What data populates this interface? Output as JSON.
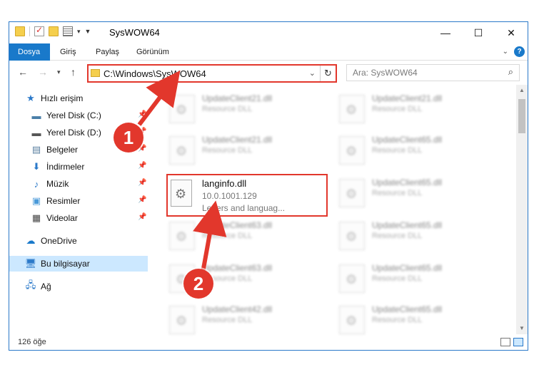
{
  "window": {
    "title": "SysWOW64",
    "controls": {
      "minimize": "—",
      "maximize": "☐",
      "close": "✕"
    }
  },
  "ribbon": {
    "tabs": [
      "Dosya",
      "Giriş",
      "Paylaş",
      "Görünüm"
    ],
    "accent_color": "#1979ca"
  },
  "nav": {
    "address": "C:\\Windows\\SysWOW64",
    "search_placeholder": "Ara: SysWOW64"
  },
  "sidebar": {
    "items": [
      {
        "label": "Hızlı erişim",
        "icon": "star-icon"
      },
      {
        "label": "Yerel Disk (C:)",
        "icon": "drive-icon",
        "pinned": true
      },
      {
        "label": "Yerel Disk (D:)",
        "icon": "drive-icon",
        "pinned": true
      },
      {
        "label": "Belgeler",
        "icon": "documents-icon",
        "pinned": true
      },
      {
        "label": "İndirmeler",
        "icon": "download-icon",
        "pinned": true
      },
      {
        "label": "Müzik",
        "icon": "music-icon",
        "pinned": true
      },
      {
        "label": "Resimler",
        "icon": "pictures-icon",
        "pinned": true
      },
      {
        "label": "Videolar",
        "icon": "videos-icon",
        "pinned": true
      },
      {
        "label": "OneDrive",
        "icon": "cloud-icon"
      },
      {
        "label": "Bu bilgisayar",
        "icon": "computer-icon",
        "selected": true
      },
      {
        "label": "Ağ",
        "icon": "network-icon"
      }
    ]
  },
  "files": {
    "blurred": [
      {
        "name": "UpdateClient21.dll",
        "desc": "Resource DLL"
      },
      {
        "name": "UpdateClient21.dll",
        "desc": "Resource DLL"
      },
      {
        "name": "UpdateClient21.dll",
        "desc": "Resource DLL"
      },
      {
        "name": "UpdateClient65.dll",
        "desc": "Resource DLL"
      },
      {
        "name": "UpdateClient65.dll",
        "desc": "Resource DLL"
      },
      {
        "name": "UpdateClient63.dll",
        "desc": "Resource DLL"
      },
      {
        "name": "UpdateClient65.dll",
        "desc": "Resource DLL"
      },
      {
        "name": "UpdateClient63.dll",
        "desc": "Resource DLL"
      },
      {
        "name": "UpdateClient65.dll",
        "desc": "Resource DLL"
      },
      {
        "name": "UpdateClient42.dll",
        "desc": "Resource DLL"
      },
      {
        "name": "UpdateClient65.dll",
        "desc": "Resource DLL"
      }
    ],
    "highlighted": {
      "name": "langinfo.dll",
      "version": "10.0.1001.129",
      "desc": "Letters and languag..."
    }
  },
  "status": {
    "item_count": "126 öğe"
  },
  "callouts": {
    "step1": "1",
    "step2": "2",
    "color": "#e2372c"
  }
}
